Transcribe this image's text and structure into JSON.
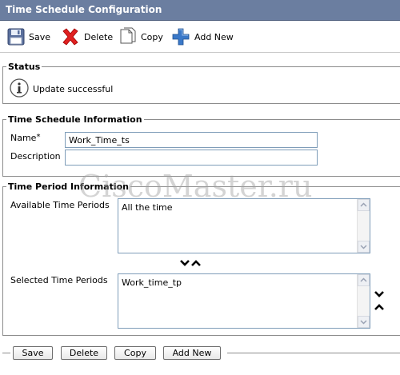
{
  "window": {
    "title": "Time Schedule Configuration"
  },
  "toolbar": {
    "save_label": "Save",
    "delete_label": "Delete",
    "copy_label": "Copy",
    "add_new_label": "Add New",
    "icons": {
      "save": "floppy-disk-icon",
      "delete": "red-x-icon",
      "copy": "copy-pages-icon",
      "add_new": "blue-plus-icon"
    }
  },
  "status": {
    "legend": "Status",
    "message": "Update successful",
    "icon": "info-icon"
  },
  "schedule_info": {
    "legend": "Time Schedule Information",
    "name_label": "Name",
    "required_marker": "*",
    "name_value": "Work_Time_ts",
    "description_label": "Description",
    "description_value": ""
  },
  "period_info": {
    "legend": "Time Period Information",
    "available_label": "Available Time Periods",
    "available_items": [
      "All the time"
    ],
    "selected_label": "Selected Time Periods",
    "selected_items": [
      "Work_time_tp"
    ]
  },
  "bottom_buttons": {
    "save": "Save",
    "delete": "Delete",
    "copy": "Copy",
    "add_new": "Add New"
  },
  "watermark": "CiscoMaster.ru",
  "colors": {
    "titlebar": "#6b7ea0",
    "titlebar_text": "#ffffff",
    "input_border": "#7f9db9",
    "section_border": "#8c8c8c",
    "delete_icon": "#e02020",
    "add_icon": "#3a78c8"
  }
}
